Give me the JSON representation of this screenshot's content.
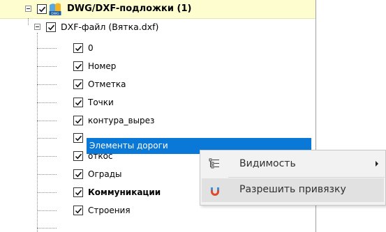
{
  "tree": {
    "root": {
      "label": "DWG/DXF-подложки (1)",
      "icon": "dwg-file-icon"
    },
    "file": {
      "label": "DXF-файл (Вятка.dxf)"
    },
    "layers": [
      {
        "label": "0"
      },
      {
        "label": "Номер"
      },
      {
        "label": "Отметка"
      },
      {
        "label": "Точки"
      },
      {
        "label": "контура_вырез"
      },
      {
        "label": "Элементы дороги"
      },
      {
        "label": "откос"
      },
      {
        "label": "Ограды"
      },
      {
        "label": "Коммуникации"
      },
      {
        "label": "Строения"
      }
    ],
    "selected_index": 5,
    "root_highlight_color": "#fdfdd0",
    "selection_color": "#0a78d7"
  },
  "context_menu": {
    "items": [
      {
        "label": "Видимость",
        "icon": "visibility-icon",
        "has_submenu": true
      },
      {
        "label": "Разрешить привязку",
        "icon": "magnet-icon"
      }
    ]
  }
}
